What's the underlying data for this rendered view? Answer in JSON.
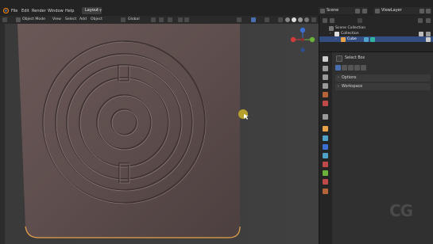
{
  "menubar": {
    "items": [
      "File",
      "Edit",
      "Render",
      "Window",
      "Help"
    ],
    "active_tab": "Layout",
    "add_tab": "+",
    "scene_label": "Scene",
    "view_layer_label": "ViewLayer"
  },
  "viewport_header": {
    "mode": "Object Mode",
    "menus": [
      "View",
      "Select",
      "Add",
      "Object"
    ],
    "orientation": "Global"
  },
  "gizmo": {
    "axes": [
      "X",
      "Y",
      "Z"
    ]
  },
  "outliner": {
    "scene_collection": "Scene Collection",
    "collection": "Collection",
    "object": "Cube"
  },
  "properties": {
    "tool_name": "Select Box",
    "panels": [
      "Options",
      "Workspace"
    ]
  },
  "watermark": "CG",
  "colors": {
    "selection_outline": "#e8a24a",
    "surface": "#5e4e4d",
    "active_row": "#334d80",
    "cursor_dot": "#cbb22a"
  }
}
